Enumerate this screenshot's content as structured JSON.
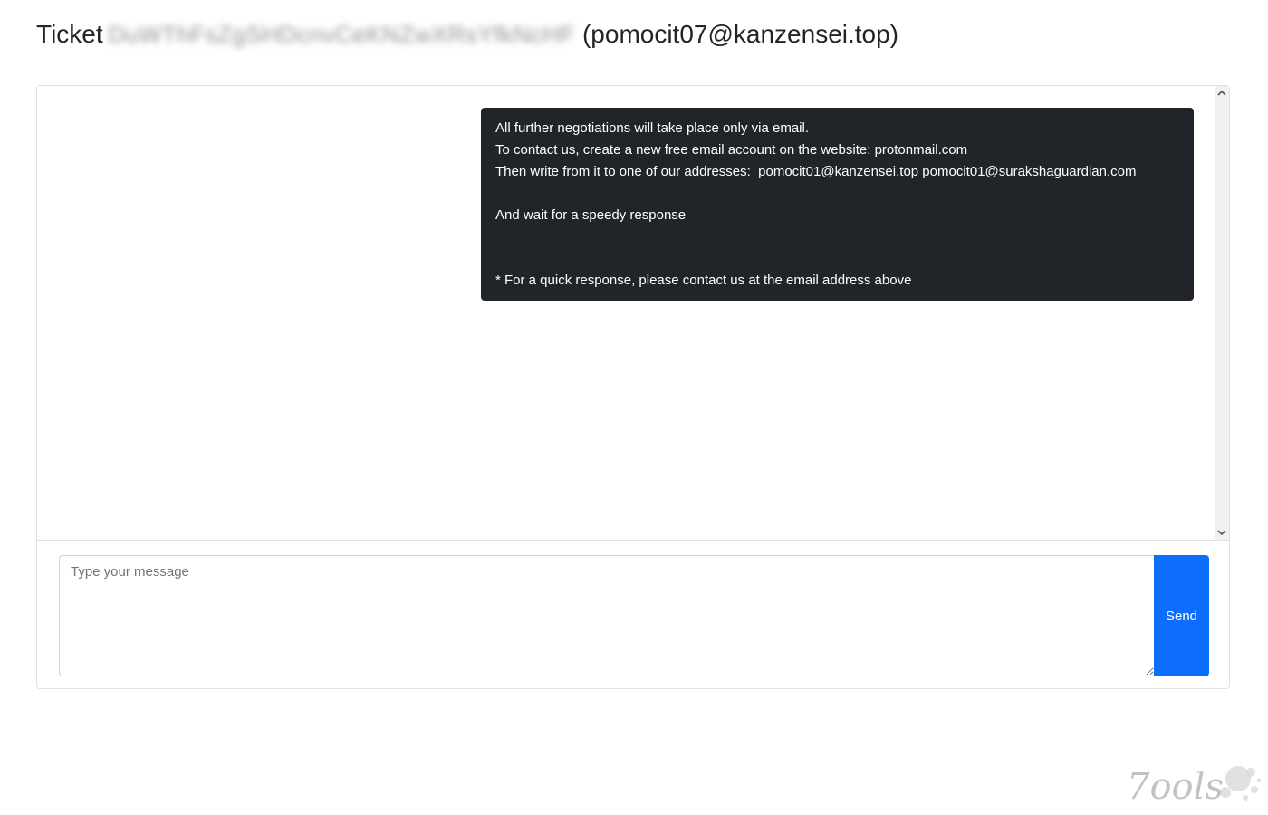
{
  "header": {
    "ticket_label": "Ticket",
    "ticket_id": "DuWThFsZgSHDcnvCeKNZwXRsYfkNcHF",
    "contact_email": "(pomocit07@kanzensei.top)"
  },
  "chat": {
    "messages": [
      {
        "lines": [
          "All further negotiations will take place only via email.",
          "To contact us, create a new free email account on the website: protonmail.com",
          "Then write from it to one of our addresses:  pomocit01@kanzensei.top pomocit01@surakshaguardian.com",
          "",
          "And wait for a speedy response",
          "",
          "",
          "* For a quick response, please contact us at the email address above"
        ]
      }
    ]
  },
  "composer": {
    "placeholder": "Type your message",
    "value": "",
    "send_label": "Send"
  },
  "watermark": {
    "text": "7ools"
  },
  "colors": {
    "bubble_bg": "#212529",
    "send_button_bg": "#0d6efd",
    "border": "#dee2e6"
  }
}
